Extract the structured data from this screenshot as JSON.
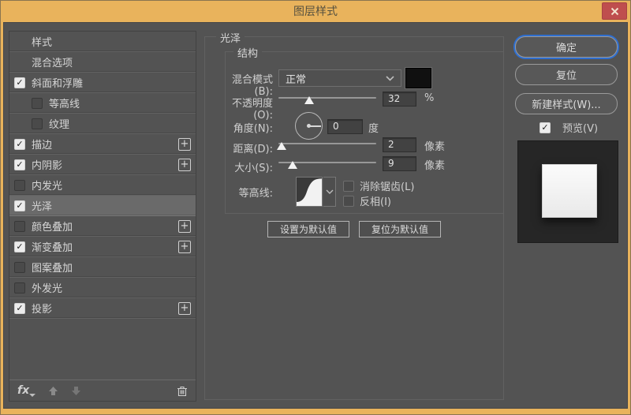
{
  "window": {
    "title": "图层样式"
  },
  "sidebar": {
    "check_glyph": "✓",
    "plus_label": "+",
    "items": [
      {
        "label": "样式",
        "checkbox": "none",
        "indent": false,
        "plus": false,
        "selected": false
      },
      {
        "label": "混合选项",
        "checkbox": "none",
        "indent": false,
        "plus": false,
        "selected": false
      },
      {
        "label": "斜面和浮雕",
        "checkbox": "checked",
        "indent": false,
        "plus": false,
        "selected": false
      },
      {
        "label": "等高线",
        "checkbox": "unchecked",
        "indent": true,
        "plus": false,
        "selected": false
      },
      {
        "label": "纹理",
        "checkbox": "unchecked",
        "indent": true,
        "plus": false,
        "selected": false
      },
      {
        "label": "描边",
        "checkbox": "checked",
        "indent": false,
        "plus": true,
        "selected": false
      },
      {
        "label": "内阴影",
        "checkbox": "checked",
        "indent": false,
        "plus": true,
        "selected": false
      },
      {
        "label": "内发光",
        "checkbox": "unchecked",
        "indent": false,
        "plus": false,
        "selected": false
      },
      {
        "label": "光泽",
        "checkbox": "checked",
        "indent": false,
        "plus": false,
        "selected": true
      },
      {
        "label": "颜色叠加",
        "checkbox": "unchecked",
        "indent": false,
        "plus": true,
        "selected": false
      },
      {
        "label": "渐变叠加",
        "checkbox": "checked",
        "indent": false,
        "plus": true,
        "selected": false
      },
      {
        "label": "图案叠加",
        "checkbox": "unchecked",
        "indent": false,
        "plus": false,
        "selected": false
      },
      {
        "label": "外发光",
        "checkbox": "unchecked",
        "indent": false,
        "plus": false,
        "selected": false
      },
      {
        "label": "投影",
        "checkbox": "checked",
        "indent": false,
        "plus": true,
        "selected": false
      }
    ],
    "toolbar": {
      "fx_label": "fx"
    }
  },
  "panel": {
    "title": "光泽",
    "group_title": "结构",
    "blend_mode": {
      "label": "混合模式(B):",
      "value": "正常",
      "swatch_color": "#101010"
    },
    "opacity": {
      "label": "不透明度(O):",
      "value": "32",
      "unit": "%"
    },
    "angle": {
      "label": "角度(N):",
      "value": "0",
      "unit": "度"
    },
    "distance": {
      "label": "距离(D):",
      "value": "2",
      "unit": "像素"
    },
    "size": {
      "label": "大小(S):",
      "value": "9",
      "unit": "像素"
    },
    "contour": {
      "label": "等高线:",
      "antialias_label": "消除锯齿(L)",
      "antialias_checked": false,
      "invert_label": "反相(I)",
      "invert_checked": false
    },
    "buttons": {
      "make_default": "设置为默认值",
      "reset_default": "复位为默认值"
    }
  },
  "actions": {
    "ok": "确定",
    "reset": "复位",
    "new_style": "新建样式(W)...",
    "preview_label": "预览(V)",
    "preview_checked": true
  },
  "colors": {
    "frame": "#e9b35c",
    "dialog_bg": "#535353",
    "selected_row": "#6a6a6a",
    "close_button": "#bf4e4e",
    "ok_focus_ring": "#2f6fd0"
  }
}
